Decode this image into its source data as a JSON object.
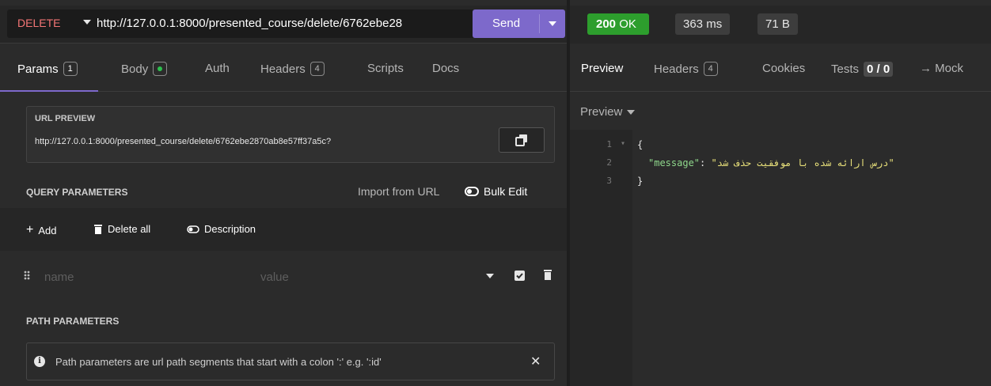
{
  "request": {
    "method": "DELETE",
    "url": "http://127.0.0.1:8000/presented_course/delete/6762ebe28",
    "send_label": "Send"
  },
  "request_tabs": [
    {
      "label": "Params",
      "badge": "1"
    },
    {
      "label": "Body"
    },
    {
      "label": "Auth"
    },
    {
      "label": "Headers",
      "badge": "4"
    },
    {
      "label": "Scripts"
    },
    {
      "label": "Docs"
    }
  ],
  "url_preview": {
    "title": "URL PREVIEW",
    "text": "http://127.0.0.1:8000/presented_course/delete/6762ebe2870ab8e57ff37a5c?"
  },
  "query_params": {
    "title": "QUERY PARAMETERS",
    "import_label": "Import from URL",
    "bulk_edit_label": "Bulk Edit",
    "add_label": "Add",
    "delete_all_label": "Delete all",
    "description_label": "Description",
    "name_placeholder": "name",
    "value_placeholder": "value"
  },
  "path_params": {
    "title": "PATH PARAMETERS",
    "info": "Path parameters are url path segments that start with a colon ':' e.g. ':id'"
  },
  "response": {
    "status": "200",
    "status_text": "OK",
    "time": "363 ms",
    "size": "71 B",
    "status_color": "#2d9e2d"
  },
  "response_tabs": [
    {
      "label": "Preview"
    },
    {
      "label": "Headers",
      "badge": "4"
    },
    {
      "label": "Cookies"
    },
    {
      "label": "Tests",
      "badge": "0 / 0"
    },
    {
      "label": "→ Mock"
    }
  ],
  "preview": {
    "mode_label": "Preview",
    "lines": [
      "1",
      "2",
      "3"
    ],
    "open_brace": "{",
    "close_brace": "}",
    "json_key": "\"message\"",
    "json_sep": ": ",
    "json_value": "\"درس ارائه شده با موفقیت حذف شد\""
  },
  "colors": {
    "accent": "#7d69cb",
    "method": "#f47575",
    "json_key": "#8fd88c",
    "json_value": "#e8e07a"
  }
}
